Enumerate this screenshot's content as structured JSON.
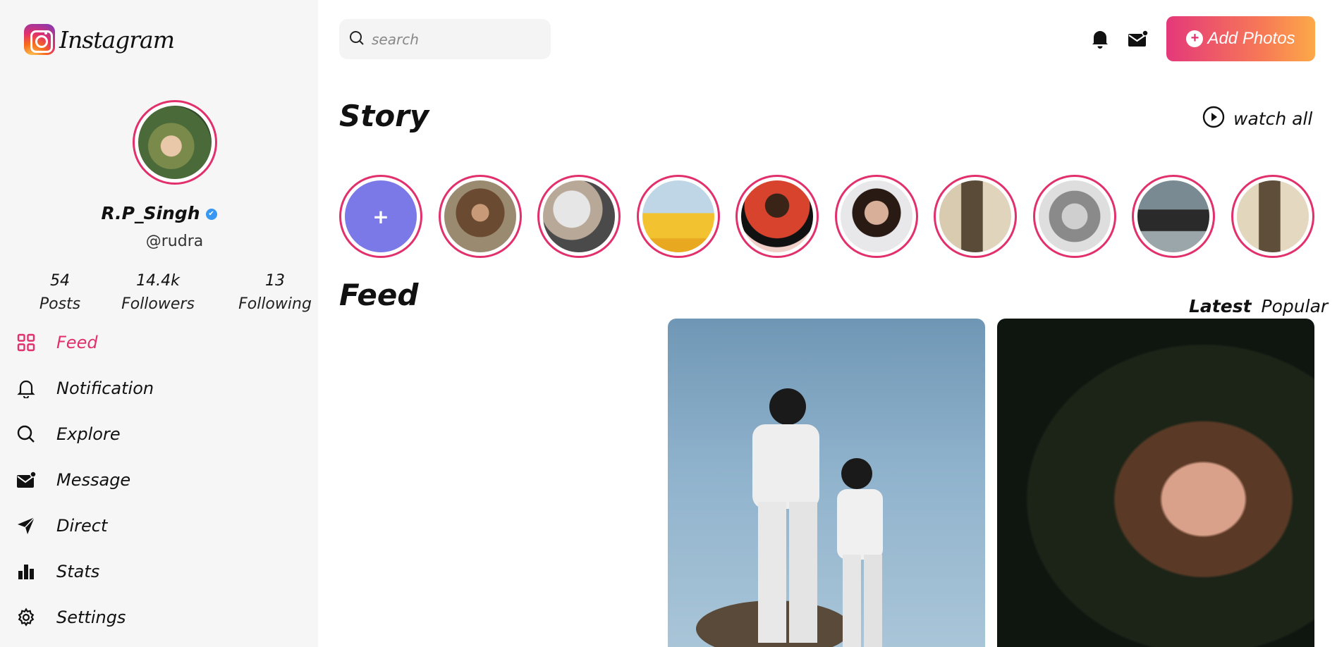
{
  "app": {
    "name": "Instagram"
  },
  "profile": {
    "name": "R.P_Singh",
    "verified_mark": "✔",
    "handle": "@rudra",
    "stats": [
      {
        "value": "54",
        "label": "Posts"
      },
      {
        "value": "14.4k",
        "label": "Followers"
      },
      {
        "value": "13",
        "label": "Following"
      }
    ]
  },
  "nav": {
    "items": [
      {
        "label": "Feed",
        "icon": "grid-icon",
        "active": true
      },
      {
        "label": "Notification",
        "icon": "bell-icon"
      },
      {
        "label": "Explore",
        "icon": "search-icon"
      },
      {
        "label": "Message",
        "icon": "mail-icon"
      },
      {
        "label": "Direct",
        "icon": "send-icon"
      },
      {
        "label": "Stats",
        "icon": "bar-chart-icon"
      },
      {
        "label": "Settings",
        "icon": "gear-icon"
      }
    ]
  },
  "header": {
    "search_placeholder": "search",
    "add_button_label": "Add Photos",
    "add_button_icon": "+"
  },
  "story": {
    "title": "Story",
    "watch_all_label": "watch all",
    "add_symbol": "+",
    "items": [
      {
        "name": "add-story"
      },
      {
        "name": "story-2"
      },
      {
        "name": "story-3"
      },
      {
        "name": "story-4"
      },
      {
        "name": "story-5"
      },
      {
        "name": "story-6"
      },
      {
        "name": "story-7"
      },
      {
        "name": "story-8"
      },
      {
        "name": "story-9"
      },
      {
        "name": "story-10"
      }
    ]
  },
  "feed": {
    "title": "Feed",
    "tabs": [
      {
        "label": "Latest",
        "active": true
      },
      {
        "label": "Popular",
        "active": false
      }
    ]
  },
  "colors": {
    "accent": "#e1306c",
    "sidebar_bg": "#f6f6f6",
    "button_gradient_start": "#e4387a",
    "button_gradient_end": "#fca948"
  }
}
